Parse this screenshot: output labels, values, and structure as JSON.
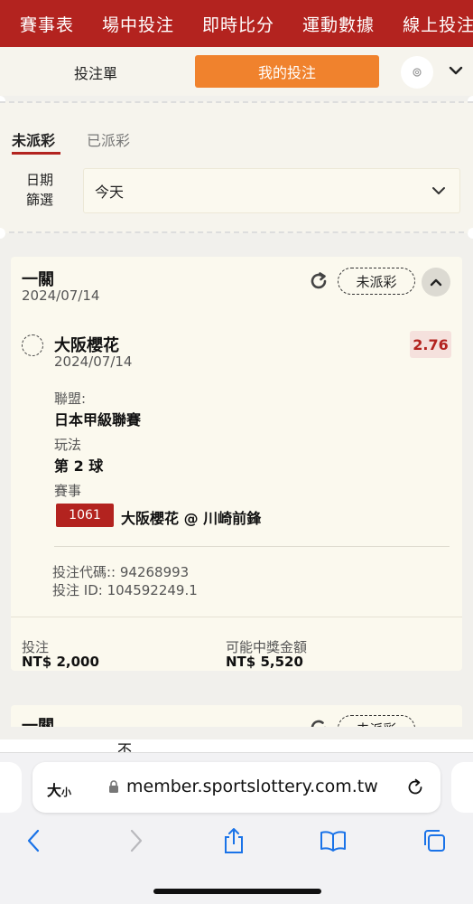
{
  "top_nav": {
    "items": [
      "賽事表",
      "場中投注",
      "即時比分",
      "運動數據",
      "線上投注"
    ]
  },
  "slip_header": {
    "bet_slip_tab": "投注單",
    "my_bets_tab": "我的投注"
  },
  "filters": {
    "tabs": {
      "unsettled": "未派彩",
      "settled": "已派彩"
    },
    "date_label": "日期篩選",
    "date_value": "今天"
  },
  "bet_card": {
    "type": "一關",
    "date": "2024/07/14",
    "status": "未派彩",
    "selection": {
      "name": "大阪櫻花",
      "date": "2024/07/14",
      "odds": "2.76",
      "league_label": "聯盟:",
      "league": "日本甲級聯賽",
      "market_label": "玩法",
      "market": "第 2 球",
      "event_label": "賽事",
      "event_code": "1061",
      "event_name": "大阪櫻花 @ 川崎前鋒"
    },
    "bet_code": "投注代碼:: 94268993",
    "bet_id": "投注 ID: 104592249.1",
    "stake_label": "投注",
    "stake_value": "NT$ 2,000",
    "payout_label": "可能中獎金額",
    "payout_value": "NT$ 5,520"
  },
  "bet_card_2": {
    "type": "一關",
    "status": "未派彩"
  },
  "partial_text": "不",
  "browser": {
    "text_size_big": "大",
    "text_size_small": "小",
    "url": "member.sportslottery.com.tw"
  },
  "colors": {
    "brand_red": "#b3231f",
    "accent_orange": "#f0822d"
  },
  "icons": [
    "gear-icon",
    "chevron-down-icon",
    "refresh-icon",
    "chevron-up-icon",
    "lock-icon",
    "reload-icon",
    "back-icon",
    "forward-icon",
    "share-icon",
    "bookmarks-icon",
    "tabs-icon"
  ]
}
